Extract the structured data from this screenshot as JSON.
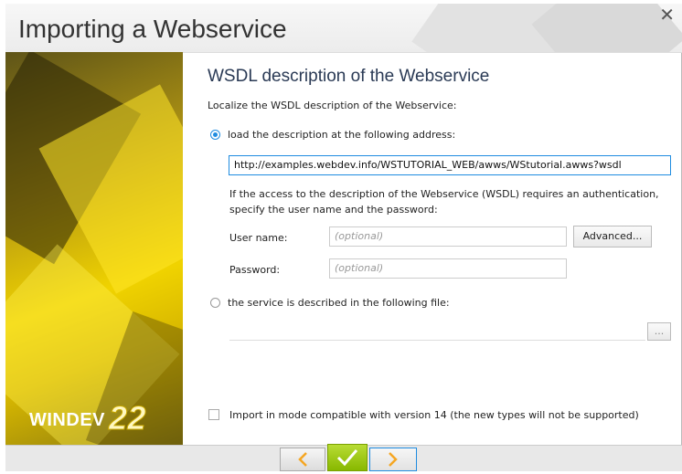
{
  "window": {
    "title": "Importing a Webservice",
    "close_glyph": "✕"
  },
  "sidebar": {
    "brand": "WINDEV",
    "version": "22"
  },
  "page": {
    "heading": "WSDL description of the Webservice",
    "intro": "Localize the WSDL description of the Webservice:"
  },
  "option_url": {
    "label": "load the description at the following address:",
    "selected": true,
    "url_value": "http://examples.webdev.info/WSTUTORIAL_WEB/awws/WStutorial.awws?wsdl"
  },
  "auth": {
    "note_line1": "If the access to the description of the Webservice (WSDL) requires an authentication,",
    "note_line2": "specify the user name and the password:",
    "username_label": "User name:",
    "username_placeholder": "(optional)",
    "password_label": "Password:",
    "password_placeholder": "(optional)",
    "advanced_button": "Advanced..."
  },
  "option_file": {
    "label": "the service is described in the following file:",
    "selected": false,
    "browse_button": "..."
  },
  "compat": {
    "label": "Import in mode compatible with version 14 (the new types will not be supported)",
    "checked": false
  },
  "colors": {
    "accent": "#1f8ce0",
    "ok_green": "#88b800",
    "arrow_orange": "#f5a623"
  },
  "icons": {
    "prev": "chevron-left-icon",
    "ok": "checkmark-icon",
    "next": "chevron-right-icon"
  }
}
